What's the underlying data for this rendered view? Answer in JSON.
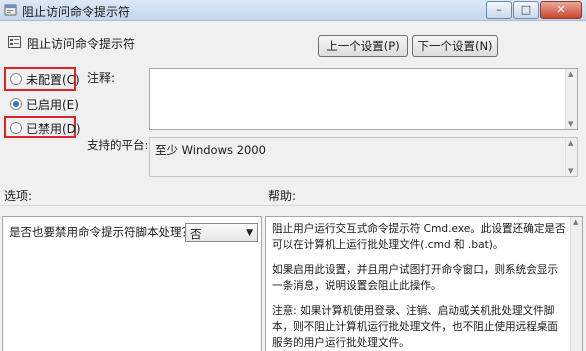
{
  "window": {
    "title": "阻止访问命令提示符",
    "controls": {
      "minimize": "–",
      "maximize": "□",
      "close": "✕"
    }
  },
  "header": {
    "policy_name": "阻止访问命令提示符",
    "prev_button": "上一个设置(P)",
    "next_button": "下一个设置(N)"
  },
  "state": {
    "options": [
      {
        "label": "未配置(C)",
        "checked": false
      },
      {
        "label": "已启用(E)",
        "checked": true
      },
      {
        "label": "已禁用(D)",
        "checked": false
      }
    ]
  },
  "comment": {
    "label": "注释:",
    "value": ""
  },
  "supported": {
    "label": "支持的平台:",
    "value": "至少 Windows 2000"
  },
  "options_section": {
    "label": "选项:",
    "question": "是否也要禁用命令提示符脚本处理？",
    "select_value": "否"
  },
  "help_section": {
    "label": "帮助:",
    "paragraphs": [
      "阻止用户运行交互式命令提示符 Cmd.exe。此设置还确定是否可以在计算机上运行批处理文件(.cmd 和 .bat)。",
      "如果启用此设置，并且用户试图打开命令窗口，则系统会显示一条消息，说明设置会阻止此操作。",
      "注意: 如果计算机使用登录、注销、启动或关机批处理文件脚本，则不阻止计算机运行批处理文件，也不阻止使用远程桌面服务的用户运行批处理文件。"
    ]
  },
  "colors": {
    "highlight_border": "#e0242b",
    "radio_fill": "#3b6fc7",
    "window_bg": "#f0f0f0",
    "titlebar": "#c4d7ee"
  }
}
